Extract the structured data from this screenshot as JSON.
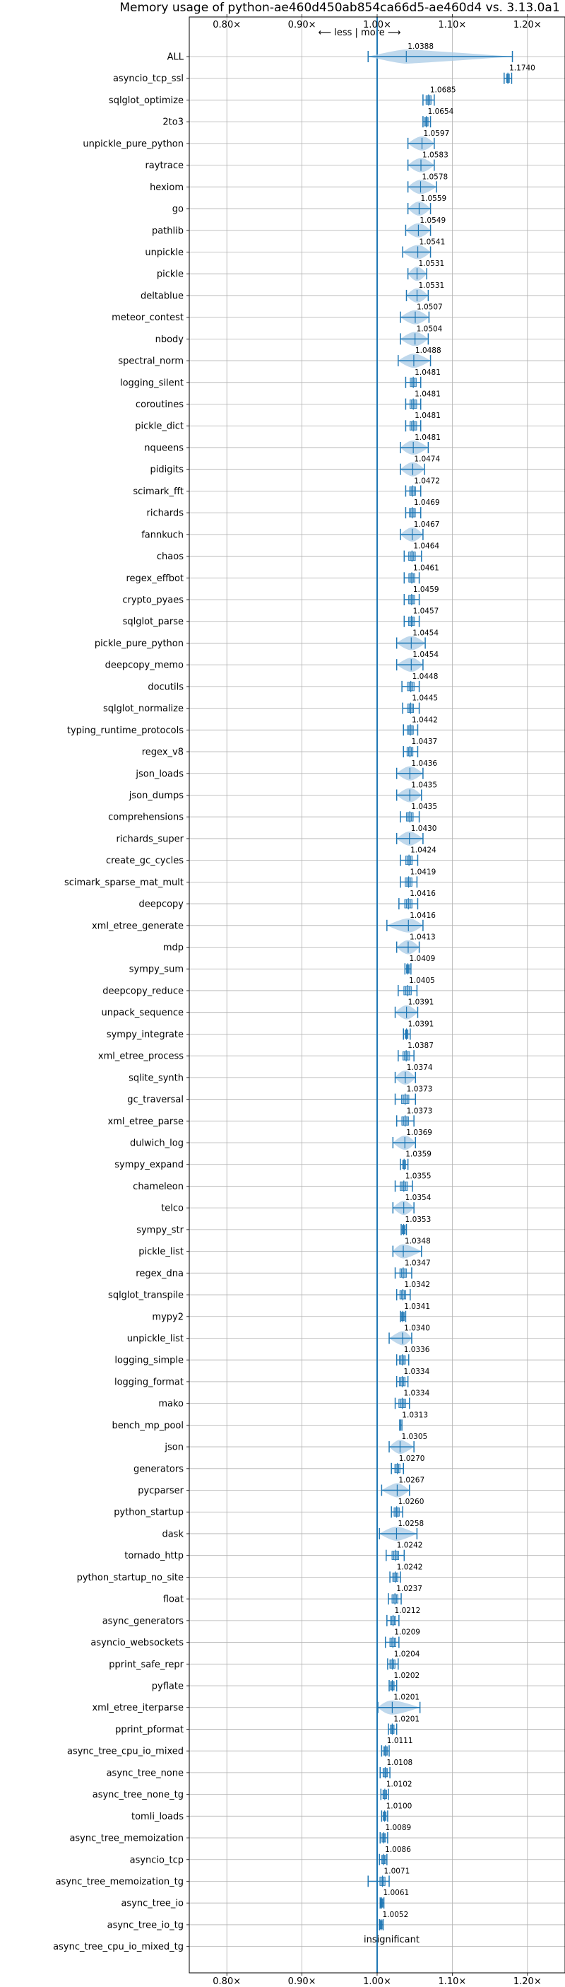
{
  "chart_data": {
    "type": "violin",
    "title": "Memory usage of python-ae460d450ab854ca66d5-ae460d4 vs. 3.13.0a1",
    "xlim": [
      0.75,
      1.25
    ],
    "xticks": [
      0.8,
      0.9,
      1.0,
      1.1,
      1.2
    ],
    "xtick_labels": [
      "0.80×",
      "0.90×",
      "1.00×",
      "1.10×",
      "1.20×"
    ],
    "direction_label": "⟵ less | more ⟶",
    "insignificant_label": "insignificant",
    "grid": true,
    "color": "#1f77b4",
    "fill_color": "#a9cbe6",
    "reference_line": 1.0,
    "rows": [
      {
        "name": "ALL",
        "value": 1.0388,
        "label": "1.0388",
        "lo": 0.988,
        "hi": 1.18,
        "width": 0.02,
        "kind": "violin"
      },
      {
        "name": "asyncio_tcp_ssl",
        "value": 1.174,
        "label": "1.1740",
        "lo": 1.169,
        "hi": 1.179,
        "width": 0.004,
        "kind": "box"
      },
      {
        "name": "sqlglot_optimize",
        "value": 1.0685,
        "label": "1.0685",
        "lo": 1.061,
        "hi": 1.076,
        "width": 0.007,
        "kind": "box"
      },
      {
        "name": "2to3",
        "value": 1.0654,
        "label": "1.0654",
        "lo": 1.061,
        "hi": 1.071,
        "width": 0.005,
        "kind": "box"
      },
      {
        "name": "unpickle_pure_python",
        "value": 1.0597,
        "label": "1.0597",
        "lo": 1.041,
        "hi": 1.076,
        "width": 0.014,
        "kind": "violin"
      },
      {
        "name": "raytrace",
        "value": 1.0583,
        "label": "1.0583",
        "lo": 1.041,
        "hi": 1.076,
        "width": 0.014,
        "kind": "violin"
      },
      {
        "name": "hexiom",
        "value": 1.0578,
        "label": "1.0578",
        "lo": 1.041,
        "hi": 1.079,
        "width": 0.014,
        "kind": "violin"
      },
      {
        "name": "go",
        "value": 1.0559,
        "label": "1.0559",
        "lo": 1.041,
        "hi": 1.071,
        "width": 0.012,
        "kind": "violin"
      },
      {
        "name": "pathlib",
        "value": 1.0549,
        "label": "1.0549",
        "lo": 1.038,
        "hi": 1.071,
        "width": 0.013,
        "kind": "violin"
      },
      {
        "name": "unpickle",
        "value": 1.0541,
        "label": "1.0541",
        "lo": 1.034,
        "hi": 1.071,
        "width": 0.014,
        "kind": "violin"
      },
      {
        "name": "pickle",
        "value": 1.0531,
        "label": "1.0531",
        "lo": 1.041,
        "hi": 1.066,
        "width": 0.01,
        "kind": "violin"
      },
      {
        "name": "deltablue",
        "value": 1.0531,
        "label": "1.0531",
        "lo": 1.039,
        "hi": 1.068,
        "width": 0.012,
        "kind": "violin"
      },
      {
        "name": "meteor_contest",
        "value": 1.0507,
        "label": "1.0507",
        "lo": 1.031,
        "hi": 1.069,
        "width": 0.014,
        "kind": "violin"
      },
      {
        "name": "nbody",
        "value": 1.0504,
        "label": "1.0504",
        "lo": 1.031,
        "hi": 1.068,
        "width": 0.014,
        "kind": "violin"
      },
      {
        "name": "spectral_norm",
        "value": 1.0488,
        "label": "1.0488",
        "lo": 1.028,
        "hi": 1.071,
        "width": 0.015,
        "kind": "violin"
      },
      {
        "name": "logging_silent",
        "value": 1.0481,
        "label": "1.0481",
        "lo": 1.038,
        "hi": 1.058,
        "width": 0.008,
        "kind": "box"
      },
      {
        "name": "coroutines",
        "value": 1.0481,
        "label": "1.0481",
        "lo": 1.038,
        "hi": 1.058,
        "width": 0.009,
        "kind": "box"
      },
      {
        "name": "pickle_dict",
        "value": 1.0481,
        "label": "1.0481",
        "lo": 1.038,
        "hi": 1.058,
        "width": 0.009,
        "kind": "box"
      },
      {
        "name": "nqueens",
        "value": 1.0481,
        "label": "1.0481",
        "lo": 1.031,
        "hi": 1.068,
        "width": 0.015,
        "kind": "violin"
      },
      {
        "name": "pidigits",
        "value": 1.0474,
        "label": "1.0474",
        "lo": 1.031,
        "hi": 1.063,
        "width": 0.012,
        "kind": "violin"
      },
      {
        "name": "scimark_fft",
        "value": 1.0472,
        "label": "1.0472",
        "lo": 1.038,
        "hi": 1.058,
        "width": 0.008,
        "kind": "box"
      },
      {
        "name": "richards",
        "value": 1.0469,
        "label": "1.0469",
        "lo": 1.038,
        "hi": 1.058,
        "width": 0.008,
        "kind": "box"
      },
      {
        "name": "fannkuch",
        "value": 1.0467,
        "label": "1.0467",
        "lo": 1.031,
        "hi": 1.061,
        "width": 0.012,
        "kind": "violin"
      },
      {
        "name": "chaos",
        "value": 1.0464,
        "label": "1.0464",
        "lo": 1.036,
        "hi": 1.059,
        "width": 0.009,
        "kind": "box"
      },
      {
        "name": "regex_effbot",
        "value": 1.0461,
        "label": "1.0461",
        "lo": 1.036,
        "hi": 1.056,
        "width": 0.008,
        "kind": "box"
      },
      {
        "name": "crypto_pyaes",
        "value": 1.0459,
        "label": "1.0459",
        "lo": 1.036,
        "hi": 1.056,
        "width": 0.008,
        "kind": "box"
      },
      {
        "name": "sqlglot_parse",
        "value": 1.0457,
        "label": "1.0457",
        "lo": 1.036,
        "hi": 1.056,
        "width": 0.008,
        "kind": "box"
      },
      {
        "name": "pickle_pure_python",
        "value": 1.0454,
        "label": "1.0454",
        "lo": 1.026,
        "hi": 1.064,
        "width": 0.014,
        "kind": "violin"
      },
      {
        "name": "deepcopy_memo",
        "value": 1.0454,
        "label": "1.0454",
        "lo": 1.026,
        "hi": 1.061,
        "width": 0.013,
        "kind": "violin"
      },
      {
        "name": "docutils",
        "value": 1.0448,
        "label": "1.0448",
        "lo": 1.033,
        "hi": 1.056,
        "width": 0.009,
        "kind": "box"
      },
      {
        "name": "sqlglot_normalize",
        "value": 1.0445,
        "label": "1.0445",
        "lo": 1.034,
        "hi": 1.056,
        "width": 0.008,
        "kind": "box"
      },
      {
        "name": "typing_runtime_protocols",
        "value": 1.0442,
        "label": "1.0442",
        "lo": 1.035,
        "hi": 1.054,
        "width": 0.008,
        "kind": "box"
      },
      {
        "name": "regex_v8",
        "value": 1.0437,
        "label": "1.0437",
        "lo": 1.035,
        "hi": 1.054,
        "width": 0.008,
        "kind": "box"
      },
      {
        "name": "json_loads",
        "value": 1.0436,
        "label": "1.0436",
        "lo": 1.026,
        "hi": 1.061,
        "width": 0.013,
        "kind": "violin"
      },
      {
        "name": "json_dumps",
        "value": 1.0435,
        "label": "1.0435",
        "lo": 1.026,
        "hi": 1.059,
        "width": 0.013,
        "kind": "violin"
      },
      {
        "name": "comprehensions",
        "value": 1.0435,
        "label": "1.0435",
        "lo": 1.031,
        "hi": 1.056,
        "width": 0.009,
        "kind": "box"
      },
      {
        "name": "richards_super",
        "value": 1.043,
        "label": "1.0430",
        "lo": 1.026,
        "hi": 1.061,
        "width": 0.012,
        "kind": "violin"
      },
      {
        "name": "create_gc_cycles",
        "value": 1.0424,
        "label": "1.0424",
        "lo": 1.031,
        "hi": 1.054,
        "width": 0.009,
        "kind": "box"
      },
      {
        "name": "scimark_sparse_mat_mult",
        "value": 1.0419,
        "label": "1.0419",
        "lo": 1.031,
        "hi": 1.053,
        "width": 0.009,
        "kind": "box"
      },
      {
        "name": "deepcopy",
        "value": 1.0416,
        "label": "1.0416",
        "lo": 1.029,
        "hi": 1.054,
        "width": 0.01,
        "kind": "box"
      },
      {
        "name": "xml_etree_generate",
        "value": 1.0416,
        "label": "1.0416",
        "lo": 1.013,
        "hi": 1.061,
        "width": 0.016,
        "kind": "violin"
      },
      {
        "name": "mdp",
        "value": 1.0413,
        "label": "1.0413",
        "lo": 1.026,
        "hi": 1.056,
        "width": 0.012,
        "kind": "violin"
      },
      {
        "name": "sympy_sum",
        "value": 1.0409,
        "label": "1.0409",
        "lo": 1.037,
        "hi": 1.045,
        "width": 0.004,
        "kind": "box"
      },
      {
        "name": "deepcopy_reduce",
        "value": 1.0405,
        "label": "1.0405",
        "lo": 1.028,
        "hi": 1.053,
        "width": 0.01,
        "kind": "box"
      },
      {
        "name": "unpack_sequence",
        "value": 1.0391,
        "label": "1.0391",
        "lo": 1.024,
        "hi": 1.054,
        "width": 0.011,
        "kind": "violin"
      },
      {
        "name": "sympy_integrate",
        "value": 1.0391,
        "label": "1.0391",
        "lo": 1.035,
        "hi": 1.044,
        "width": 0.004,
        "kind": "box"
      },
      {
        "name": "xml_etree_process",
        "value": 1.0387,
        "label": "1.0387",
        "lo": 1.028,
        "hi": 1.049,
        "width": 0.009,
        "kind": "box"
      },
      {
        "name": "sqlite_synth",
        "value": 1.0374,
        "label": "1.0374",
        "lo": 1.024,
        "hi": 1.051,
        "width": 0.012,
        "kind": "violin"
      },
      {
        "name": "gc_traversal",
        "value": 1.0373,
        "label": "1.0373",
        "lo": 1.024,
        "hi": 1.051,
        "width": 0.01,
        "kind": "box"
      },
      {
        "name": "xml_etree_parse",
        "value": 1.0373,
        "label": "1.0373",
        "lo": 1.026,
        "hi": 1.049,
        "width": 0.009,
        "kind": "box"
      },
      {
        "name": "dulwich_log",
        "value": 1.0369,
        "label": "1.0369",
        "lo": 1.021,
        "hi": 1.051,
        "width": 0.012,
        "kind": "violin"
      },
      {
        "name": "sympy_expand",
        "value": 1.0359,
        "label": "1.0359",
        "lo": 1.031,
        "hi": 1.041,
        "width": 0.004,
        "kind": "box"
      },
      {
        "name": "chameleon",
        "value": 1.0355,
        "label": "1.0355",
        "lo": 1.024,
        "hi": 1.047,
        "width": 0.01,
        "kind": "box"
      },
      {
        "name": "telco",
        "value": 1.0354,
        "label": "1.0354",
        "lo": 1.021,
        "hi": 1.049,
        "width": 0.011,
        "kind": "violin"
      },
      {
        "name": "sympy_str",
        "value": 1.0353,
        "label": "1.0353",
        "lo": 1.032,
        "hi": 1.039,
        "width": 0.004,
        "kind": "box"
      },
      {
        "name": "pickle_list",
        "value": 1.0348,
        "label": "1.0348",
        "lo": 1.021,
        "hi": 1.059,
        "width": 0.013,
        "kind": "violin"
      },
      {
        "name": "regex_dna",
        "value": 1.0347,
        "label": "1.0347",
        "lo": 1.024,
        "hi": 1.046,
        "width": 0.009,
        "kind": "box"
      },
      {
        "name": "sqlglot_transpile",
        "value": 1.0342,
        "label": "1.0342",
        "lo": 1.026,
        "hi": 1.044,
        "width": 0.008,
        "kind": "box"
      },
      {
        "name": "mypy2",
        "value": 1.0341,
        "label": "1.0341",
        "lo": 1.031,
        "hi": 1.038,
        "width": 0.004,
        "kind": "box"
      },
      {
        "name": "unpickle_list",
        "value": 1.034,
        "label": "1.0340",
        "lo": 1.016,
        "hi": 1.046,
        "width": 0.01,
        "kind": "violin"
      },
      {
        "name": "logging_simple",
        "value": 1.0336,
        "label": "1.0336",
        "lo": 1.026,
        "hi": 1.042,
        "width": 0.008,
        "kind": "box"
      },
      {
        "name": "logging_format",
        "value": 1.0334,
        "label": "1.0334",
        "lo": 1.026,
        "hi": 1.041,
        "width": 0.008,
        "kind": "box"
      },
      {
        "name": "mako",
        "value": 1.0334,
        "label": "1.0334",
        "lo": 1.024,
        "hi": 1.043,
        "width": 0.009,
        "kind": "box"
      },
      {
        "name": "bench_mp_pool",
        "value": 1.0313,
        "label": "1.0313",
        "lo": 1.03,
        "hi": 1.033,
        "width": 0.001,
        "kind": "line"
      },
      {
        "name": "json",
        "value": 1.0305,
        "label": "1.0305",
        "lo": 1.016,
        "hi": 1.049,
        "width": 0.01,
        "kind": "violin"
      },
      {
        "name": "generators",
        "value": 1.027,
        "label": "1.0270",
        "lo": 1.019,
        "hi": 1.035,
        "width": 0.007,
        "kind": "box"
      },
      {
        "name": "pycparser",
        "value": 1.0267,
        "label": "1.0267",
        "lo": 1.006,
        "hi": 1.043,
        "width": 0.011,
        "kind": "violin"
      },
      {
        "name": "python_startup",
        "value": 1.026,
        "label": "1.0260",
        "lo": 1.019,
        "hi": 1.034,
        "width": 0.007,
        "kind": "box"
      },
      {
        "name": "dask",
        "value": 1.0258,
        "label": "1.0258",
        "lo": 1.003,
        "hi": 1.053,
        "width": 0.014,
        "kind": "violin"
      },
      {
        "name": "tornado_http",
        "value": 1.0242,
        "label": "1.0242",
        "lo": 1.012,
        "hi": 1.036,
        "width": 0.009,
        "kind": "box"
      },
      {
        "name": "python_startup_no_site",
        "value": 1.0242,
        "label": "1.0242",
        "lo": 1.017,
        "hi": 1.031,
        "width": 0.007,
        "kind": "box"
      },
      {
        "name": "float",
        "value": 1.0237,
        "label": "1.0237",
        "lo": 1.015,
        "hi": 1.032,
        "width": 0.008,
        "kind": "box"
      },
      {
        "name": "async_generators",
        "value": 1.0212,
        "label": "1.0212",
        "lo": 1.013,
        "hi": 1.029,
        "width": 0.007,
        "kind": "box"
      },
      {
        "name": "asyncio_websockets",
        "value": 1.0209,
        "label": "1.0209",
        "lo": 1.011,
        "hi": 1.029,
        "width": 0.008,
        "kind": "box"
      },
      {
        "name": "pprint_safe_repr",
        "value": 1.0204,
        "label": "1.0204",
        "lo": 1.014,
        "hi": 1.028,
        "width": 0.007,
        "kind": "box"
      },
      {
        "name": "pyflate",
        "value": 1.0202,
        "label": "1.0202",
        "lo": 1.016,
        "hi": 1.026,
        "width": 0.005,
        "kind": "box"
      },
      {
        "name": "xml_etree_iterparse",
        "value": 1.0201,
        "label": "1.0201",
        "lo": 1.001,
        "hi": 1.057,
        "width": 0.018,
        "kind": "violin"
      },
      {
        "name": "pprint_pformat",
        "value": 1.0201,
        "label": "1.0201",
        "lo": 1.015,
        "hi": 1.026,
        "width": 0.005,
        "kind": "box"
      },
      {
        "name": "async_tree_cpu_io_mixed",
        "value": 1.0111,
        "label": "1.0111",
        "lo": 1.006,
        "hi": 1.016,
        "width": 0.005,
        "kind": "box"
      },
      {
        "name": "async_tree_none",
        "value": 1.0108,
        "label": "1.0108",
        "lo": 1.004,
        "hi": 1.017,
        "width": 0.006,
        "kind": "box"
      },
      {
        "name": "async_tree_none_tg",
        "value": 1.0102,
        "label": "1.0102",
        "lo": 1.005,
        "hi": 1.015,
        "width": 0.005,
        "kind": "box"
      },
      {
        "name": "tomli_loads",
        "value": 1.01,
        "label": "1.0100",
        "lo": 1.006,
        "hi": 1.014,
        "width": 0.004,
        "kind": "box"
      },
      {
        "name": "async_tree_memoization",
        "value": 1.0089,
        "label": "1.0089",
        "lo": 1.004,
        "hi": 1.014,
        "width": 0.005,
        "kind": "box"
      },
      {
        "name": "asyncio_tcp",
        "value": 1.0086,
        "label": "1.0086",
        "lo": 1.003,
        "hi": 1.013,
        "width": 0.005,
        "kind": "box"
      },
      {
        "name": "async_tree_memoization_tg",
        "value": 1.0071,
        "label": "1.0071",
        "lo": 0.988,
        "hi": 1.016,
        "width": 0.007,
        "kind": "box"
      },
      {
        "name": "async_tree_io",
        "value": 1.0061,
        "label": "1.0061",
        "lo": 1.004,
        "hi": 1.009,
        "width": 0.003,
        "kind": "box"
      },
      {
        "name": "async_tree_io_tg",
        "value": 1.0052,
        "label": "1.0052",
        "lo": 1.003,
        "hi": 1.008,
        "width": 0.003,
        "kind": "box"
      },
      {
        "name": "async_tree_cpu_io_mixed_tg",
        "value": null,
        "label": "",
        "lo": null,
        "hi": null,
        "width": 0,
        "kind": "none"
      }
    ]
  }
}
